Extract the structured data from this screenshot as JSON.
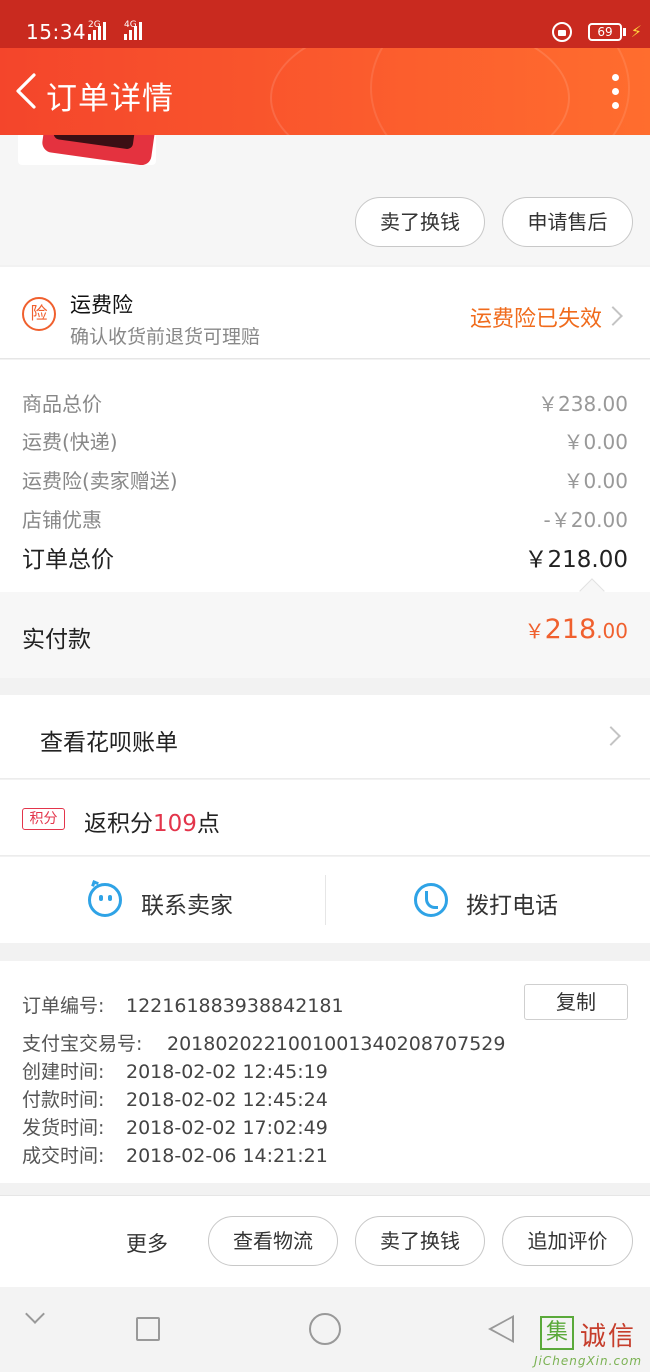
{
  "status_bar": {
    "time": "15:34",
    "signal1_tag": "2G",
    "signal2_tag": "4G",
    "battery": "69"
  },
  "header": {
    "title": "订单详情"
  },
  "product_actions": {
    "sell_exchange": "卖了换钱",
    "after_sales": "申请售后"
  },
  "insurance": {
    "icon_char": "险",
    "title": "运费险",
    "subtitle": "确认收货前退货可理赔",
    "status": "运费险已失效"
  },
  "prices": {
    "rows": [
      {
        "label": "商品总价",
        "value": "￥238.00"
      },
      {
        "label": "运费(快递)",
        "value": "￥0.00"
      },
      {
        "label": "运费险(卖家赠送)",
        "value": "￥0.00"
      },
      {
        "label": "店铺优惠",
        "value": "-￥20.00"
      }
    ],
    "total_label": "订单总价",
    "total_value": "￥218.00",
    "paid_label": "实付款",
    "paid_currency": "￥",
    "paid_int": "218",
    "paid_dec": ".00"
  },
  "huabei": {
    "label": "查看花呗账单"
  },
  "points": {
    "badge": "积分",
    "prefix": "返积分",
    "count": "109",
    "suffix": "点"
  },
  "contact": {
    "seller": "联系卖家",
    "phone": "拨打电话"
  },
  "order_info": {
    "copy": "复制",
    "rows": [
      {
        "key": "订单编号:",
        "value": "122161883938842181"
      },
      {
        "key": "支付宝交易号:",
        "value": "2018020221001001340208707529"
      },
      {
        "key": "创建时间:",
        "value": "2018-02-02 12:45:19"
      },
      {
        "key": "付款时间:",
        "value": "2018-02-02 12:45:24"
      },
      {
        "key": "发货时间:",
        "value": "2018-02-02 17:02:49"
      },
      {
        "key": "成交时间:",
        "value": "2018-02-06 14:21:21"
      }
    ]
  },
  "bottom_actions": {
    "more": "更多",
    "logistics": "查看物流",
    "sell_exchange": "卖了换钱",
    "add_review": "追加评价"
  },
  "watermark": {
    "logo": "集",
    "cn": "诚信",
    "en": "JiChengXin.com"
  },
  "colors": {
    "accent": "#f0602e",
    "header_red": "#f4452b",
    "points_red": "#e3354b",
    "contact_blue": "#2fa3e6"
  }
}
